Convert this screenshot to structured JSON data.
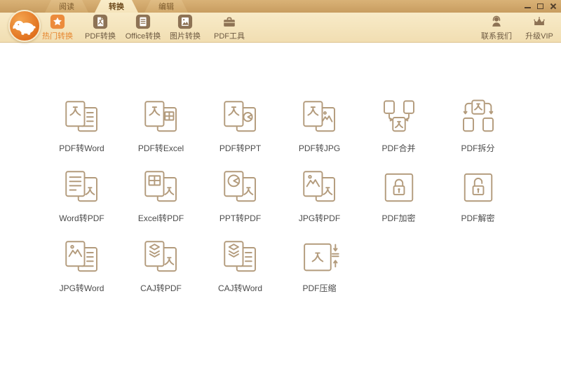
{
  "colors": {
    "orange": "#ec8b3c",
    "brown": "#8d7254",
    "cream": "#f5e5bd",
    "tan_strip": "#cda267",
    "icon_stroke": "#b39b7c",
    "grid_label": "#4b4b4b"
  },
  "titlebar": {
    "tabs": [
      {
        "name": "tab-read",
        "label": "阅读",
        "active": false
      },
      {
        "name": "tab-convert",
        "label": "转换",
        "active": true
      },
      {
        "name": "tab-edit",
        "label": "编辑",
        "active": false
      }
    ],
    "window_controls": [
      {
        "name": "minimize-button",
        "icon": "minimize-icon"
      },
      {
        "name": "maximize-button",
        "icon": "maximize-icon"
      },
      {
        "name": "close-button",
        "icon": "close-icon"
      }
    ]
  },
  "toolbar": {
    "items": [
      {
        "name": "toolbar-item-hot-convert",
        "label": "热门转换",
        "icon": "hot-star-icon",
        "active": true
      },
      {
        "name": "toolbar-item-pdf-convert",
        "label": "PDF转换",
        "icon": "pdf-file-icon",
        "active": false
      },
      {
        "name": "toolbar-item-office-convert",
        "label": "Office转换",
        "icon": "office-doc-icon",
        "active": false
      },
      {
        "name": "toolbar-item-image-convert",
        "label": "图片转换",
        "icon": "image-file-icon",
        "active": false
      },
      {
        "name": "toolbar-item-pdf-tools",
        "label": "PDF工具",
        "icon": "toolbox-icon",
        "active": false
      }
    ],
    "right_items": [
      {
        "name": "toolbar-item-contact-us",
        "label": "联系我们",
        "icon": "headset-person-icon"
      },
      {
        "name": "toolbar-item-upgrade-vip",
        "label": "升级VIP",
        "icon": "crown-icon"
      }
    ]
  },
  "grid": {
    "items": [
      {
        "name": "grid-item-pdf-to-word",
        "label": "PDF转Word",
        "icon": "pdf-to-word"
      },
      {
        "name": "grid-item-pdf-to-excel",
        "label": "PDF转Excel",
        "icon": "pdf-to-excel"
      },
      {
        "name": "grid-item-pdf-to-ppt",
        "label": "PDF转PPT",
        "icon": "pdf-to-ppt"
      },
      {
        "name": "grid-item-pdf-to-jpg",
        "label": "PDF转JPG",
        "icon": "pdf-to-jpg"
      },
      {
        "name": "grid-item-pdf-merge",
        "label": "PDF合并",
        "icon": "pdf-merge"
      },
      {
        "name": "grid-item-pdf-split",
        "label": "PDF拆分",
        "icon": "pdf-split"
      },
      {
        "name": "grid-item-word-to-pdf",
        "label": "Word转PDF",
        "icon": "word-to-pdf"
      },
      {
        "name": "grid-item-excel-to-pdf",
        "label": "Excel转PDF",
        "icon": "excel-to-pdf"
      },
      {
        "name": "grid-item-ppt-to-pdf",
        "label": "PPT转PDF",
        "icon": "ppt-to-pdf"
      },
      {
        "name": "grid-item-jpg-to-pdf",
        "label": "JPG转PDF",
        "icon": "jpg-to-pdf"
      },
      {
        "name": "grid-item-pdf-encrypt",
        "label": "PDF加密",
        "icon": "pdf-encrypt"
      },
      {
        "name": "grid-item-pdf-decrypt",
        "label": "PDF解密",
        "icon": "pdf-decrypt"
      },
      {
        "name": "grid-item-jpg-to-word",
        "label": "JPG转Word",
        "icon": "jpg-to-word"
      },
      {
        "name": "grid-item-caj-to-pdf",
        "label": "CAJ转PDF",
        "icon": "caj-to-pdf"
      },
      {
        "name": "grid-item-caj-to-word",
        "label": "CAJ转Word",
        "icon": "caj-to-word"
      },
      {
        "name": "grid-item-pdf-compress",
        "label": "PDF压缩",
        "icon": "pdf-compress"
      }
    ]
  }
}
